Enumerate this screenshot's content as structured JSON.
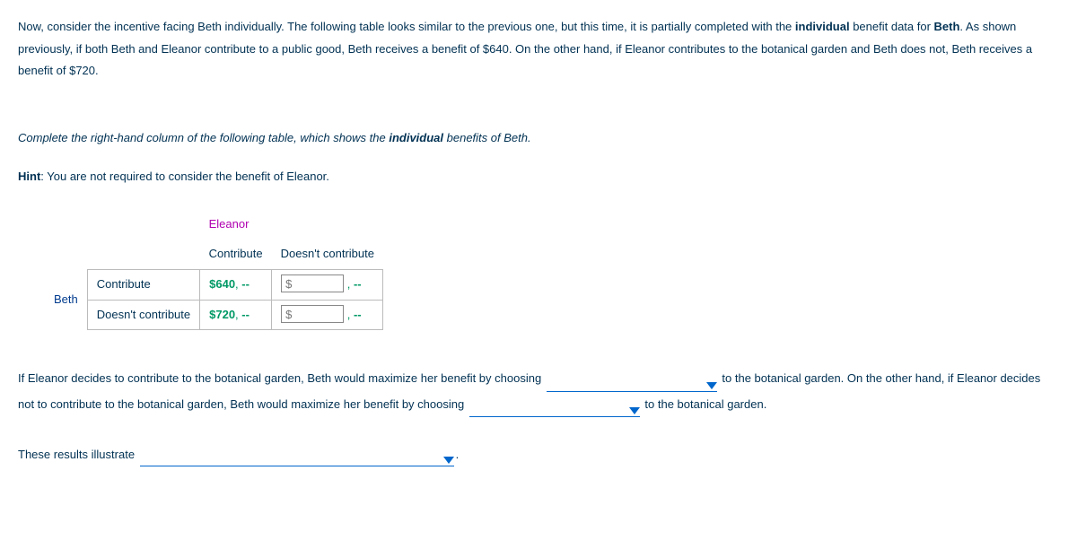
{
  "intro": {
    "text_a": "Now, consider the incentive facing Beth individually. The following table looks similar to the previous one, but this time, it is partially completed with the ",
    "bold_a": "individual",
    "text_b": " benefit data for ",
    "bold_b": "Beth",
    "text_c": ". As shown previously, if both Beth and Eleanor contribute to a public good, Beth receives a benefit of $640. On the other hand, if Eleanor contributes to the botanical garden and Beth does not, Beth receives a benefit of $720."
  },
  "instruction": {
    "text_a": "Complete the right-hand column of the following table, which shows the ",
    "bold_a": "individual",
    "text_b": " benefits of Beth."
  },
  "hint": {
    "label": "Hint",
    "text": ": You are not required to consider the benefit of Eleanor."
  },
  "table": {
    "col_player": "Eleanor",
    "row_player": "Beth",
    "col_contrib": "Contribute",
    "col_nocontrib": "Doesn't contribute",
    "row_contrib": "Contribute",
    "row_nocontrib": "Doesn't contribute",
    "val_cc": "$640",
    "val_nc": "$720",
    "dash": "--",
    "placeholder": "$"
  },
  "fill": {
    "s1a": "If Eleanor decides to contribute to the botanical garden, Beth would maximize her benefit by choosing ",
    "s1b": " to the botanical garden. On the other hand, if Eleanor decides not to contribute to the botanical garden, Beth would maximize her benefit by choosing ",
    "s1c": " to the botanical garden."
  },
  "results": {
    "text": "These results illustrate ",
    "period": "."
  }
}
